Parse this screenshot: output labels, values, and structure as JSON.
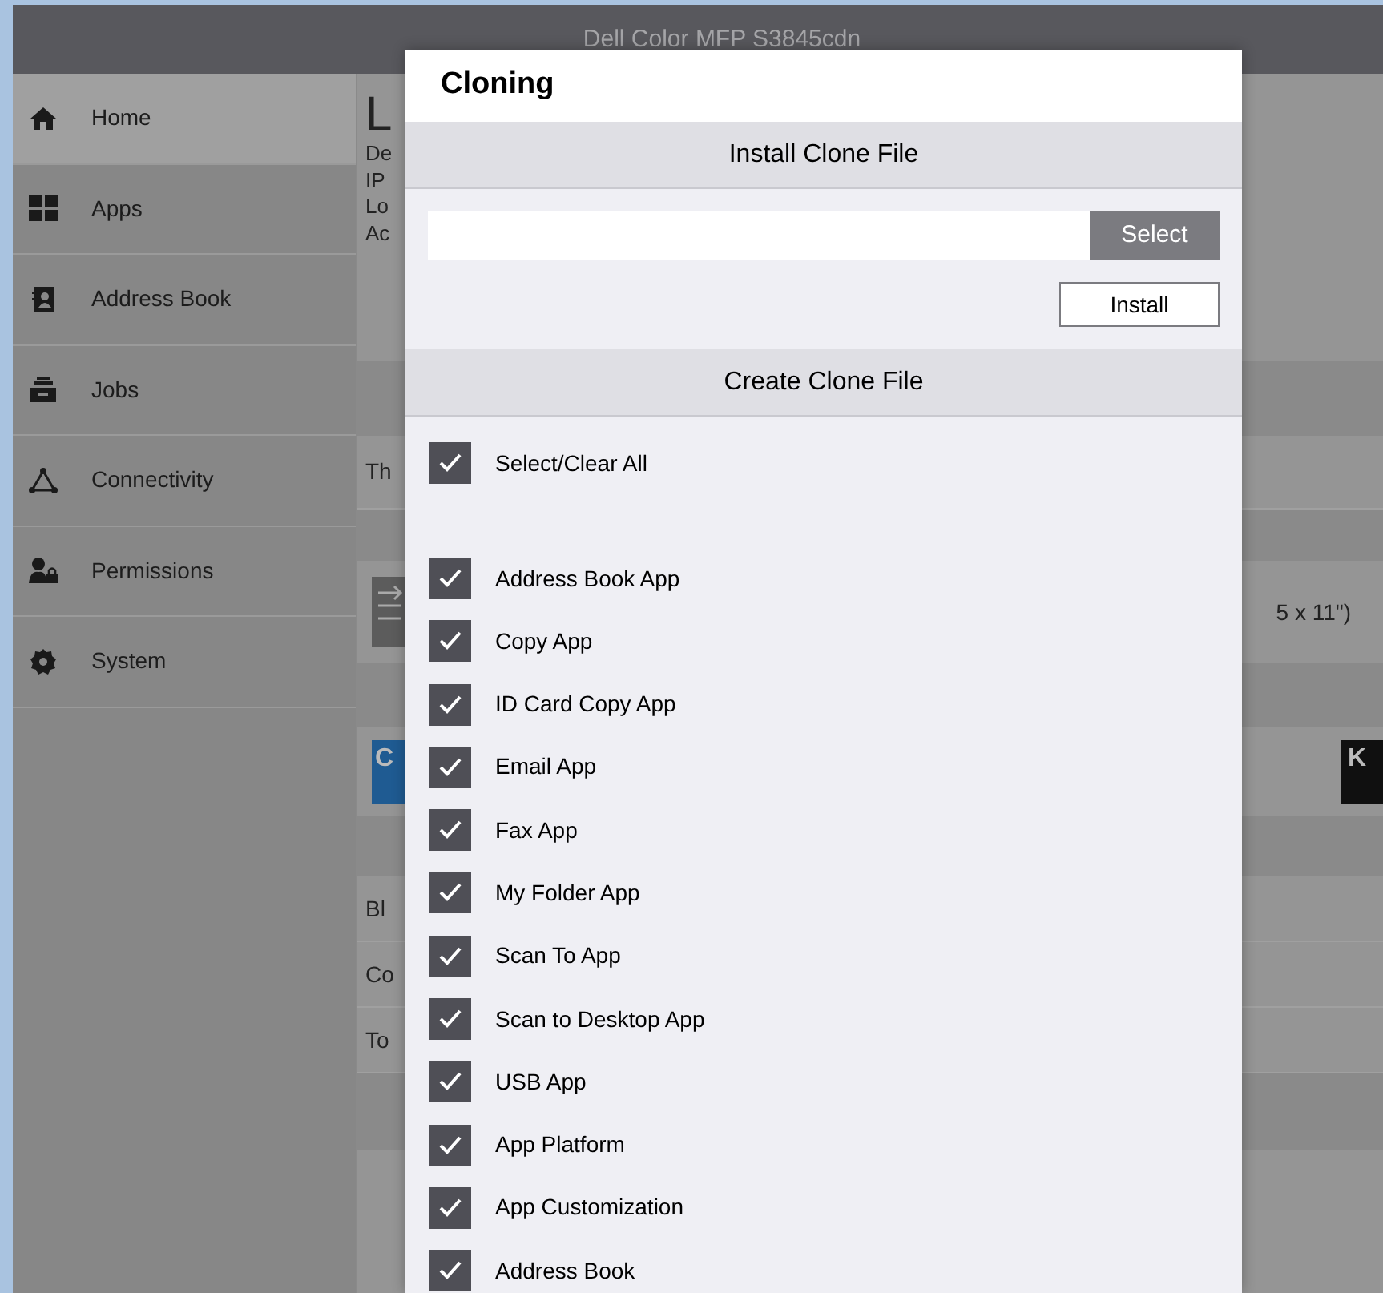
{
  "header": {
    "title": "Dell Color MFP S3845cdn"
  },
  "sidebar": {
    "items": [
      {
        "label": "Home",
        "selected": true
      },
      {
        "label": "Apps",
        "selected": false
      },
      {
        "label": "Address Book",
        "selected": false
      },
      {
        "label": "Jobs",
        "selected": false
      },
      {
        "label": "Connectivity",
        "selected": false
      },
      {
        "label": "Permissions",
        "selected": false
      },
      {
        "label": "System",
        "selected": false
      }
    ]
  },
  "background": {
    "heading": "L",
    "info_lines": [
      "De",
      "IP",
      "Lo",
      "Ac"
    ],
    "row_1": "Th",
    "tray_size": "5 x 11\")",
    "toner_left": "C",
    "toner_right": "K",
    "counters": [
      "Bl",
      "Co",
      "To"
    ]
  },
  "dialog": {
    "title": "Cloning",
    "install_section": {
      "heading": "Install Clone File",
      "select_button": "Select",
      "install_button": "Install"
    },
    "create_section": {
      "heading": "Create Clone File",
      "select_all": {
        "label": "Select/Clear All",
        "checked": true
      },
      "items": [
        {
          "label": "Address Book App",
          "checked": true
        },
        {
          "label": "Copy App",
          "checked": true
        },
        {
          "label": "ID Card Copy App",
          "checked": true
        },
        {
          "label": "Email App",
          "checked": true
        },
        {
          "label": "Fax App",
          "checked": true
        },
        {
          "label": "My Folder App",
          "checked": true
        },
        {
          "label": "Scan To App",
          "checked": true
        },
        {
          "label": "Scan to Desktop App",
          "checked": true
        },
        {
          "label": "USB App",
          "checked": true
        },
        {
          "label": "App Platform",
          "checked": true
        },
        {
          "label": "App Customization",
          "checked": true
        },
        {
          "label": "Address Book",
          "checked": true
        }
      ]
    }
  }
}
